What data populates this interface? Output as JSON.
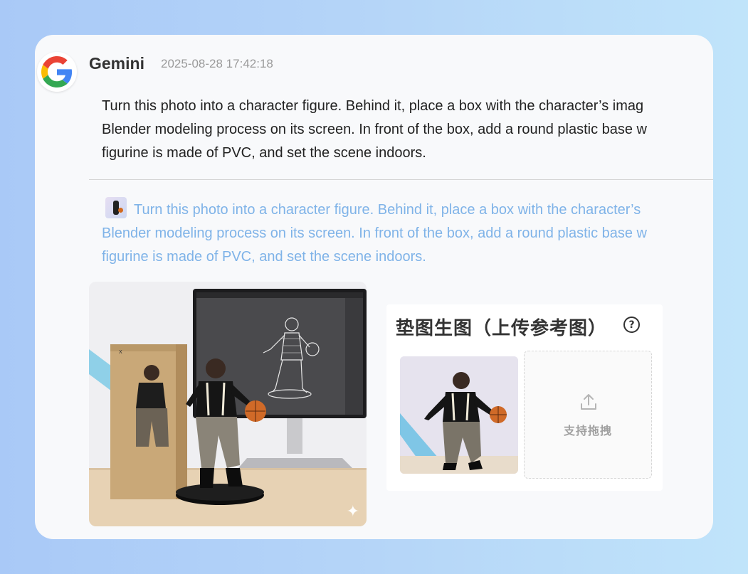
{
  "message": {
    "sender": "Gemini",
    "timestamp": "2025-08-28 17:42:18",
    "prompt_lines": [
      "Turn this photo into a character figure. Behind it, place a box with the character’s imag",
      "Blender modeling process on its screen. In front of the box, add a round plastic base w",
      "figurine is made of PVC, and set the scene indoors."
    ]
  },
  "reply": {
    "lines": [
      "Turn this photo into a character figure. Behind it, place a box with the character’s",
      "Blender modeling process on its screen. In front of the box, add a round plastic base w",
      "figurine is made of PVC, and set the scene indoors."
    ],
    "color": "#7fb3e8"
  },
  "upload_panel": {
    "title": "垫图生图（上传参考图）",
    "help_icon_label": "?",
    "dropzone_label": "支持拖拽"
  },
  "icons": {
    "logo": "google-g-logo",
    "sparkle": "sparkle-icon",
    "help": "question-circle-icon",
    "upload": "upload-arrow-icon"
  }
}
